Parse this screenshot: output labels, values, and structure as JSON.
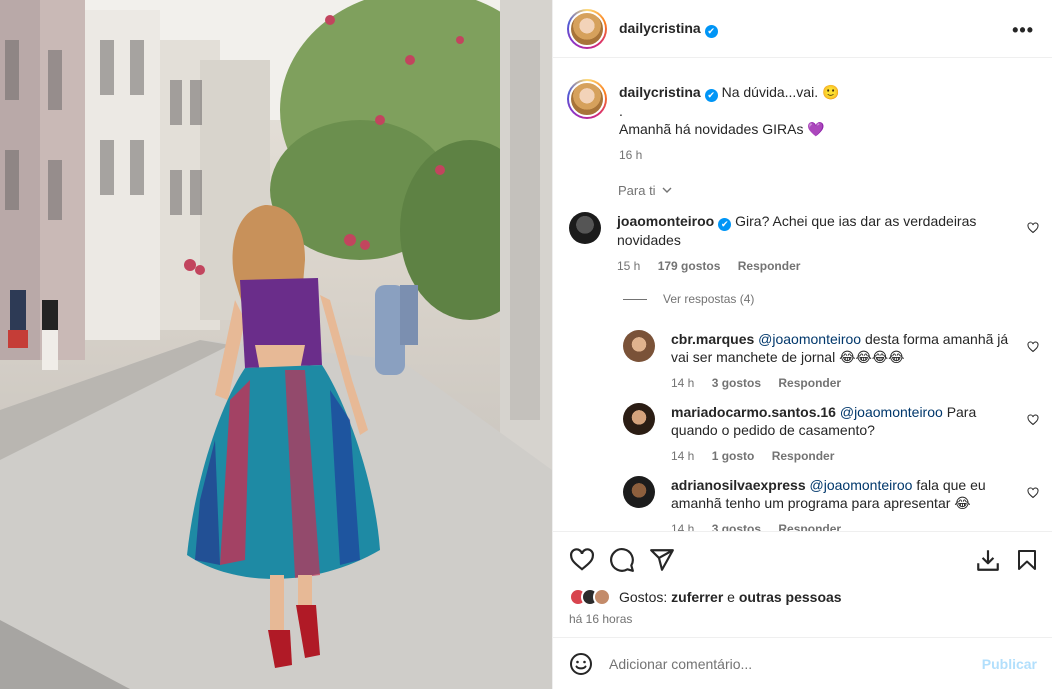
{
  "post": {
    "username": "dailycristina",
    "verified_mark": "✔",
    "more_label": "•••"
  },
  "caption": {
    "username": "dailycristina",
    "line1": "Na dúvida...vai. 🙂",
    "line2": ".",
    "line3": "Amanhã há novidades GIRAs 💜",
    "time": "16 h"
  },
  "sort_label": "Para ti",
  "comments": [
    {
      "username": "joaomonteiroo",
      "verified": true,
      "text": "Gira? Achei que ias dar as verdadeiras novidades",
      "time": "15 h",
      "likes": "179 gostos",
      "reply": "Responder"
    }
  ],
  "view_replies": "Ver respostas (4)",
  "replies": [
    {
      "username": "cbr.marques",
      "mention": "@joaomonteiroo",
      "text": "desta forma amanhã já vai ser manchete de jornal 😂😂😂😂",
      "time": "14 h",
      "likes": "3 gostos",
      "reply": "Responder"
    },
    {
      "username": "mariadocarmo.santos.16",
      "mention": "@joaomonteiroo",
      "text": "Para quando o pedido de casamento?",
      "time": "14 h",
      "likes": "1 gosto",
      "reply": "Responder"
    },
    {
      "username": "adrianosilvaexpress",
      "mention": "@joaomonteiroo",
      "text": "fala que eu amanhã tenho um programa para apresentar 😂",
      "time": "14 h",
      "likes": "3 gostos",
      "reply": "Responder"
    }
  ],
  "likes_summary": {
    "prefix": "Gostos:",
    "user": "zuferrer",
    "conj": "e",
    "others": "outras pessoas"
  },
  "posted_ago": "há 16 horas",
  "add_comment": {
    "placeholder": "Adicionar comentário...",
    "publish": "Publicar"
  },
  "icons": [
    "heart-icon",
    "comment-icon",
    "share-icon",
    "download-icon",
    "bookmark-icon",
    "emoji-icon",
    "chevron-down-icon",
    "more-icon"
  ],
  "colors": {
    "accent": "#0095f6",
    "mention": "#00376b",
    "muted": "#737373",
    "publish_disabled": "#b2dffc"
  }
}
